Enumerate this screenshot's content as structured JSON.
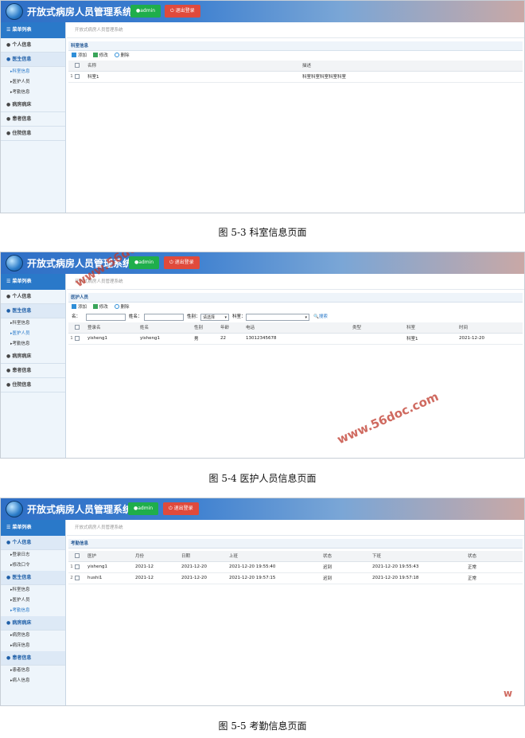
{
  "app": {
    "title": "开放式病房人员管理系统",
    "admin_label": "admin",
    "logout_label": "退出登录",
    "menu_label": "菜单列表",
    "breadcrumb": "开放式病房人员管理系统"
  },
  "icons": {
    "logo": "globe-people-logo-icon",
    "menu": "menu-list-icon",
    "user": "user-icon",
    "add": "add-file-icon",
    "edit": "edit-icon",
    "delete": "delete-circle-icon",
    "search": "search-icon",
    "admin": "person-icon",
    "logout": "power-icon"
  },
  "colors": {
    "header_start": "#2f6fc6",
    "header_end": "#c9a8a6",
    "admin_button": "#1fae4b",
    "logout_button": "#e04a3c",
    "sidebar_head": "#2a79c9"
  },
  "toolbar": {
    "add": "添加",
    "edit": "修改",
    "delete": "删除"
  },
  "shot1": {
    "sidebar": [
      {
        "type": "group",
        "label": "个人信息"
      },
      {
        "type": "group",
        "label": "医生信息",
        "open": true
      },
      {
        "type": "item",
        "label": "科室信息",
        "active": true
      },
      {
        "type": "item",
        "label": "医护人员"
      },
      {
        "type": "item",
        "label": "考勤信息"
      },
      {
        "type": "group",
        "label": "病房病床"
      },
      {
        "type": "group",
        "label": "患者信息"
      },
      {
        "type": "group",
        "label": "住院信息"
      }
    ],
    "panel_title": "科室信息",
    "columns": [
      "名称",
      "描述"
    ],
    "rows": [
      [
        "1",
        "科室1",
        "科室科室科室科室科室"
      ]
    ],
    "caption": "图 5-3 科室信息页面"
  },
  "shot2": {
    "sidebar": [
      {
        "type": "group",
        "label": "个人信息"
      },
      {
        "type": "group",
        "label": "医生信息",
        "open": true
      },
      {
        "type": "item",
        "label": "科室信息"
      },
      {
        "type": "item",
        "label": "医护人员",
        "active": true
      },
      {
        "type": "item",
        "label": "考勤信息"
      },
      {
        "type": "group",
        "label": "病房病床"
      },
      {
        "type": "group",
        "label": "患者信息"
      },
      {
        "type": "group",
        "label": "住院信息"
      }
    ],
    "panel_title": "医护人员",
    "search": {
      "field1_label": "名：",
      "field2_label": "姓名：",
      "gender_label": "性别：",
      "gender_value": "请选择",
      "dept_label": "科室：",
      "search_button": "搜索"
    },
    "columns": [
      "登录名",
      "姓名",
      "性别",
      "年龄",
      "电话",
      "类型",
      "科室",
      "时间"
    ],
    "rows": [
      [
        "1",
        "yisheng1",
        "yisheng1",
        "男",
        "22",
        "13012345678",
        "",
        "科室1",
        "2021-12-20"
      ]
    ],
    "caption": "图 5-4 医护人员信息页面"
  },
  "shot3": {
    "sidebar": [
      {
        "type": "group",
        "label": "个人信息",
        "open": true
      },
      {
        "type": "item",
        "label": "登录日志"
      },
      {
        "type": "item",
        "label": "修改口令"
      },
      {
        "type": "group",
        "label": "医生信息",
        "open": true
      },
      {
        "type": "item",
        "label": "科室信息"
      },
      {
        "type": "item",
        "label": "医护人员"
      },
      {
        "type": "item",
        "label": "考勤信息",
        "active": true
      },
      {
        "type": "group",
        "label": "病房病床",
        "open": true
      },
      {
        "type": "item",
        "label": "病房信息"
      },
      {
        "type": "item",
        "label": "病床信息"
      },
      {
        "type": "group",
        "label": "患者信息",
        "open": true
      },
      {
        "type": "item",
        "label": "患者信息"
      },
      {
        "type": "item",
        "label": "病人信息"
      }
    ],
    "panel_title": "考勤信息",
    "columns": [
      "医护",
      "月份",
      "日期",
      "上班",
      "状态",
      "下班",
      "状态"
    ],
    "rows": [
      [
        "1",
        "yisheng1",
        "2021-12",
        "2021-12-20",
        "2021-12-20 19:55:40",
        "迟到",
        "2021-12-20 19:55:43",
        "正常"
      ],
      [
        "2",
        "hushi1",
        "2021-12",
        "2021-12-20",
        "2021-12-20 19:57:15",
        "迟到",
        "2021-12-20 19:57:18",
        "正常"
      ]
    ],
    "caption": "图 5-5 考勤信息页面"
  },
  "watermarks": [
    "www.56doc.com",
    "www.56doc.com",
    "w"
  ]
}
